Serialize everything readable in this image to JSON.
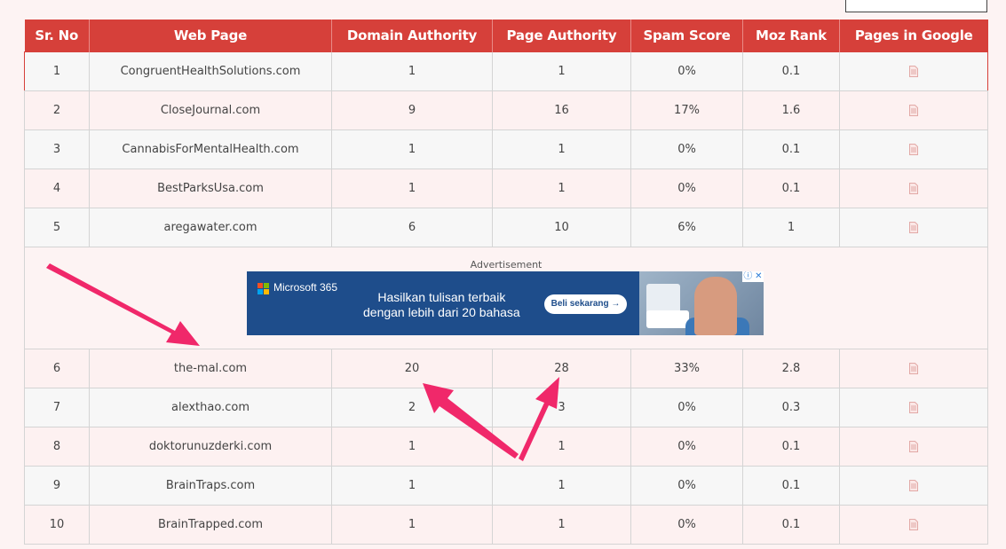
{
  "table": {
    "headers": [
      "Sr. No",
      "Web Page",
      "Domain Authority",
      "Page Authority",
      "Spam Score",
      "Moz Rank",
      "Pages in Google"
    ],
    "rows_before_ad": [
      {
        "sr": "1",
        "page": "CongruentHealthSolutions.com",
        "da": "1",
        "pa": "1",
        "spam": "0%",
        "moz": "0.1"
      },
      {
        "sr": "2",
        "page": "CloseJournal.com",
        "da": "9",
        "pa": "16",
        "spam": "17%",
        "moz": "1.6"
      },
      {
        "sr": "3",
        "page": "CannabisForMentalHealth.com",
        "da": "1",
        "pa": "1",
        "spam": "0%",
        "moz": "0.1"
      },
      {
        "sr": "4",
        "page": "BestParksUsa.com",
        "da": "1",
        "pa": "1",
        "spam": "0%",
        "moz": "0.1"
      },
      {
        "sr": "5",
        "page": "aregawater.com",
        "da": "6",
        "pa": "10",
        "spam": "6%",
        "moz": "1"
      }
    ],
    "rows_after_ad": [
      {
        "sr": "6",
        "page": "the-mal.com",
        "da": "20",
        "pa": "28",
        "spam": "33%",
        "moz": "2.8"
      },
      {
        "sr": "7",
        "page": "alexthao.com",
        "da": "2",
        "pa": "3",
        "spam": "0%",
        "moz": "0.3"
      },
      {
        "sr": "8",
        "page": "doktorunuzderki.com",
        "da": "1",
        "pa": "1",
        "spam": "0%",
        "moz": "0.1"
      },
      {
        "sr": "9",
        "page": "BrainTraps.com",
        "da": "1",
        "pa": "1",
        "spam": "0%",
        "moz": "0.1"
      },
      {
        "sr": "10",
        "page": "BrainTrapped.com",
        "da": "1",
        "pa": "1",
        "spam": "0%",
        "moz": "0.1"
      }
    ]
  },
  "ad": {
    "label": "Advertisement",
    "brand": "Microsoft 365",
    "line1": "Hasilkan tulisan terbaik",
    "line2": "dengan lebih dari 20 bahasa",
    "cta": "Beli sekarang →",
    "close": "ⓘ ✕"
  },
  "colors": {
    "header_bg": "#d6403a",
    "arrow": "#f0286a",
    "ad_bg": "#1e4d8b",
    "icon": "#e2a9a6"
  },
  "icons": {
    "pages_in_google": "document-icon"
  }
}
